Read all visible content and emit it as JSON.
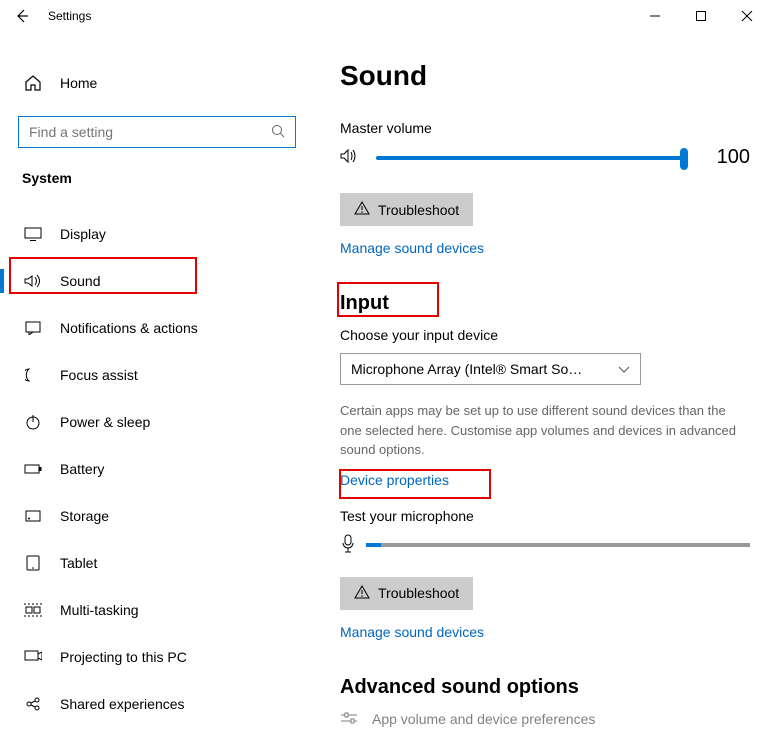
{
  "app_title": "Settings",
  "sidebar": {
    "home": "Home",
    "search_placeholder": "Find a setting",
    "category": "System",
    "items": [
      {
        "label": "Display",
        "icon": "display"
      },
      {
        "label": "Sound",
        "icon": "sound"
      },
      {
        "label": "Notifications & actions",
        "icon": "notifications"
      },
      {
        "label": "Focus assist",
        "icon": "focus"
      },
      {
        "label": "Power & sleep",
        "icon": "power"
      },
      {
        "label": "Battery",
        "icon": "battery"
      },
      {
        "label": "Storage",
        "icon": "storage"
      },
      {
        "label": "Tablet",
        "icon": "tablet"
      },
      {
        "label": "Multi-tasking",
        "icon": "multitask"
      },
      {
        "label": "Projecting to this PC",
        "icon": "project"
      },
      {
        "label": "Shared experiences",
        "icon": "shared"
      }
    ]
  },
  "main": {
    "title": "Sound",
    "master_label": "Master volume",
    "master_value": "100",
    "troubleshoot": "Troubleshoot",
    "manage": "Manage sound devices",
    "input_heading": "Input",
    "choose_input": "Choose your input device",
    "input_device": "Microphone Array (Intel® Smart So…",
    "input_desc": "Certain apps may be set up to use different sound devices than the one selected here. Customise app volumes and devices in advanced sound options.",
    "device_props": "Device properties",
    "test_mic": "Test your microphone",
    "advanced_heading": "Advanced sound options",
    "app_volume": "App volume and device preferences"
  }
}
